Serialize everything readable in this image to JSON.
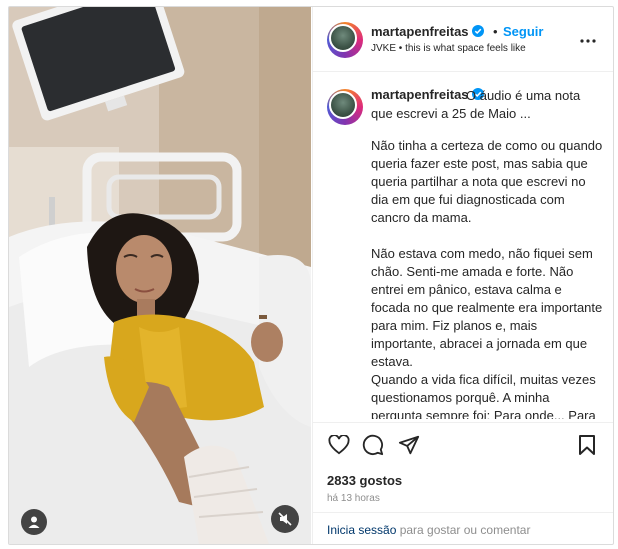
{
  "post": {
    "username": "martapenfreitas",
    "separator_dot": "•",
    "follow_label": "Seguir",
    "song_artist": "JVKE",
    "song_separator": "•",
    "song_title": "this is what space feels like",
    "caption_first": "O áudio é uma nota que escrevi a 25 de Maio ...",
    "caption_p1": "Não tinha a certeza de como ou quando queria fazer este post, mas sabia que queria partilhar a nota que escrevi no dia em que fui diagnosticada com cancro da mama.",
    "caption_p2": "Não estava com medo, não fiquei sem chão. Senti-me amada e forte. Não entrei em pânico, estava calma e focada no que realmente era importante para mim. Fiz planos e, mais importante, abracei a jornada em que estava.",
    "caption_p3": "Quando a vida fica difícil, muitas vezes questionamos porquê. A minha pergunta sempre foi: Para onde... Para onde é que a vida me está a levar?",
    "likes": "2833 gostos",
    "time_ago": "há 13 horas",
    "login_link": "Inicia sessão",
    "login_rest": " para gostar ou comentar"
  },
  "icons": {
    "verified": "verified-badge-icon",
    "more": "more-options-icon",
    "like": "heart-icon",
    "comment": "comment-icon",
    "share": "share-icon",
    "save": "bookmark-icon",
    "user_tags": "user-icon",
    "mute": "muted-speaker-icon"
  },
  "colors": {
    "accent": "#0095f6",
    "link": "#00376b",
    "muted_text": "#8e8e8e",
    "text": "#262626",
    "border": "#dbdbdb"
  }
}
